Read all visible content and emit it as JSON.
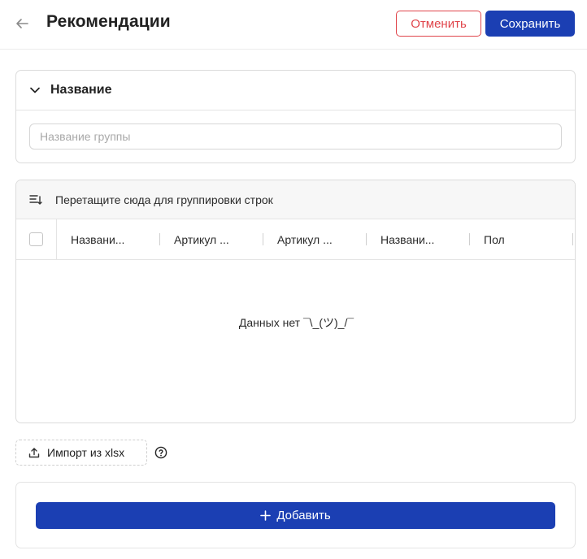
{
  "header": {
    "title": "Рекомендации",
    "back_icon": "arrow-left-icon",
    "cancel_label": "Отменить",
    "save_label": "Сохранить"
  },
  "name_section": {
    "title": "Название",
    "chevron_icon": "chevron-down-icon",
    "input_value": "",
    "input_placeholder": "Название группы"
  },
  "grid": {
    "group_panel_text": "Перетащите сюда для группировки строк",
    "group_icon": "group-rows-icon",
    "columns": [
      {
        "label": "Названи..."
      },
      {
        "label": "Артикул ..."
      },
      {
        "label": "Артикул ..."
      },
      {
        "label": "Названи..."
      },
      {
        "label": "Пол"
      }
    ],
    "empty_message": "Данных нет ¯\\_(ツ)_/¯",
    "rows": []
  },
  "import": {
    "label": "Импорт из xlsx",
    "icon": "upload-icon",
    "help_icon": "help-circle-icon"
  },
  "add": {
    "label": "Добавить",
    "icon": "plus-icon"
  },
  "colors": {
    "primary": "#1b3fb3",
    "danger": "#e0454b",
    "border": "#dcdcdc",
    "panel_bg": "#f7f7f7"
  }
}
